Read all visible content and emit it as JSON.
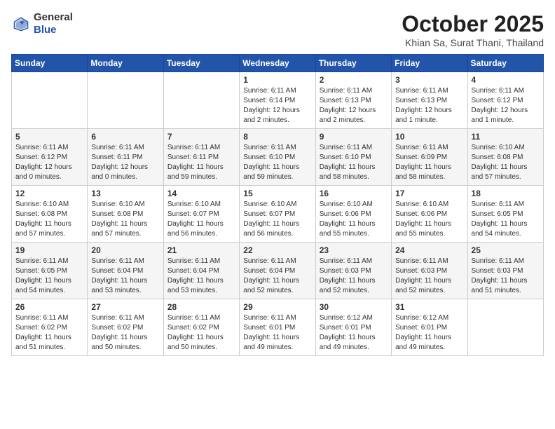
{
  "header": {
    "logo_general": "General",
    "logo_blue": "Blue",
    "month": "October 2025",
    "location": "Khian Sa, Surat Thani, Thailand"
  },
  "weekdays": [
    "Sunday",
    "Monday",
    "Tuesday",
    "Wednesday",
    "Thursday",
    "Friday",
    "Saturday"
  ],
  "weeks": [
    [
      {
        "day": "",
        "sunrise": "",
        "sunset": "",
        "daylight": ""
      },
      {
        "day": "",
        "sunrise": "",
        "sunset": "",
        "daylight": ""
      },
      {
        "day": "",
        "sunrise": "",
        "sunset": "",
        "daylight": ""
      },
      {
        "day": "1",
        "sunrise": "Sunrise: 6:11 AM",
        "sunset": "Sunset: 6:14 PM",
        "daylight": "Daylight: 12 hours and 2 minutes."
      },
      {
        "day": "2",
        "sunrise": "Sunrise: 6:11 AM",
        "sunset": "Sunset: 6:13 PM",
        "daylight": "Daylight: 12 hours and 2 minutes."
      },
      {
        "day": "3",
        "sunrise": "Sunrise: 6:11 AM",
        "sunset": "Sunset: 6:13 PM",
        "daylight": "Daylight: 12 hours and 1 minute."
      },
      {
        "day": "4",
        "sunrise": "Sunrise: 6:11 AM",
        "sunset": "Sunset: 6:12 PM",
        "daylight": "Daylight: 12 hours and 1 minute."
      }
    ],
    [
      {
        "day": "5",
        "sunrise": "Sunrise: 6:11 AM",
        "sunset": "Sunset: 6:12 PM",
        "daylight": "Daylight: 12 hours and 0 minutes."
      },
      {
        "day": "6",
        "sunrise": "Sunrise: 6:11 AM",
        "sunset": "Sunset: 6:11 PM",
        "daylight": "Daylight: 12 hours and 0 minutes."
      },
      {
        "day": "7",
        "sunrise": "Sunrise: 6:11 AM",
        "sunset": "Sunset: 6:11 PM",
        "daylight": "Daylight: 11 hours and 59 minutes."
      },
      {
        "day": "8",
        "sunrise": "Sunrise: 6:11 AM",
        "sunset": "Sunset: 6:10 PM",
        "daylight": "Daylight: 11 hours and 59 minutes."
      },
      {
        "day": "9",
        "sunrise": "Sunrise: 6:11 AM",
        "sunset": "Sunset: 6:10 PM",
        "daylight": "Daylight: 11 hours and 58 minutes."
      },
      {
        "day": "10",
        "sunrise": "Sunrise: 6:11 AM",
        "sunset": "Sunset: 6:09 PM",
        "daylight": "Daylight: 11 hours and 58 minutes."
      },
      {
        "day": "11",
        "sunrise": "Sunrise: 6:10 AM",
        "sunset": "Sunset: 6:08 PM",
        "daylight": "Daylight: 11 hours and 57 minutes."
      }
    ],
    [
      {
        "day": "12",
        "sunrise": "Sunrise: 6:10 AM",
        "sunset": "Sunset: 6:08 PM",
        "daylight": "Daylight: 11 hours and 57 minutes."
      },
      {
        "day": "13",
        "sunrise": "Sunrise: 6:10 AM",
        "sunset": "Sunset: 6:08 PM",
        "daylight": "Daylight: 11 hours and 57 minutes."
      },
      {
        "day": "14",
        "sunrise": "Sunrise: 6:10 AM",
        "sunset": "Sunset: 6:07 PM",
        "daylight": "Daylight: 11 hours and 56 minutes."
      },
      {
        "day": "15",
        "sunrise": "Sunrise: 6:10 AM",
        "sunset": "Sunset: 6:07 PM",
        "daylight": "Daylight: 11 hours and 56 minutes."
      },
      {
        "day": "16",
        "sunrise": "Sunrise: 6:10 AM",
        "sunset": "Sunset: 6:06 PM",
        "daylight": "Daylight: 11 hours and 55 minutes."
      },
      {
        "day": "17",
        "sunrise": "Sunrise: 6:10 AM",
        "sunset": "Sunset: 6:06 PM",
        "daylight": "Daylight: 11 hours and 55 minutes."
      },
      {
        "day": "18",
        "sunrise": "Sunrise: 6:11 AM",
        "sunset": "Sunset: 6:05 PM",
        "daylight": "Daylight: 11 hours and 54 minutes."
      }
    ],
    [
      {
        "day": "19",
        "sunrise": "Sunrise: 6:11 AM",
        "sunset": "Sunset: 6:05 PM",
        "daylight": "Daylight: 11 hours and 54 minutes."
      },
      {
        "day": "20",
        "sunrise": "Sunrise: 6:11 AM",
        "sunset": "Sunset: 6:04 PM",
        "daylight": "Daylight: 11 hours and 53 minutes."
      },
      {
        "day": "21",
        "sunrise": "Sunrise: 6:11 AM",
        "sunset": "Sunset: 6:04 PM",
        "daylight": "Daylight: 11 hours and 53 minutes."
      },
      {
        "day": "22",
        "sunrise": "Sunrise: 6:11 AM",
        "sunset": "Sunset: 6:04 PM",
        "daylight": "Daylight: 11 hours and 52 minutes."
      },
      {
        "day": "23",
        "sunrise": "Sunrise: 6:11 AM",
        "sunset": "Sunset: 6:03 PM",
        "daylight": "Daylight: 11 hours and 52 minutes."
      },
      {
        "day": "24",
        "sunrise": "Sunrise: 6:11 AM",
        "sunset": "Sunset: 6:03 PM",
        "daylight": "Daylight: 11 hours and 52 minutes."
      },
      {
        "day": "25",
        "sunrise": "Sunrise: 6:11 AM",
        "sunset": "Sunset: 6:03 PM",
        "daylight": "Daylight: 11 hours and 51 minutes."
      }
    ],
    [
      {
        "day": "26",
        "sunrise": "Sunrise: 6:11 AM",
        "sunset": "Sunset: 6:02 PM",
        "daylight": "Daylight: 11 hours and 51 minutes."
      },
      {
        "day": "27",
        "sunrise": "Sunrise: 6:11 AM",
        "sunset": "Sunset: 6:02 PM",
        "daylight": "Daylight: 11 hours and 50 minutes."
      },
      {
        "day": "28",
        "sunrise": "Sunrise: 6:11 AM",
        "sunset": "Sunset: 6:02 PM",
        "daylight": "Daylight: 11 hours and 50 minutes."
      },
      {
        "day": "29",
        "sunrise": "Sunrise: 6:11 AM",
        "sunset": "Sunset: 6:01 PM",
        "daylight": "Daylight: 11 hours and 49 minutes."
      },
      {
        "day": "30",
        "sunrise": "Sunrise: 6:12 AM",
        "sunset": "Sunset: 6:01 PM",
        "daylight": "Daylight: 11 hours and 49 minutes."
      },
      {
        "day": "31",
        "sunrise": "Sunrise: 6:12 AM",
        "sunset": "Sunset: 6:01 PM",
        "daylight": "Daylight: 11 hours and 49 minutes."
      },
      {
        "day": "",
        "sunrise": "",
        "sunset": "",
        "daylight": ""
      }
    ]
  ]
}
